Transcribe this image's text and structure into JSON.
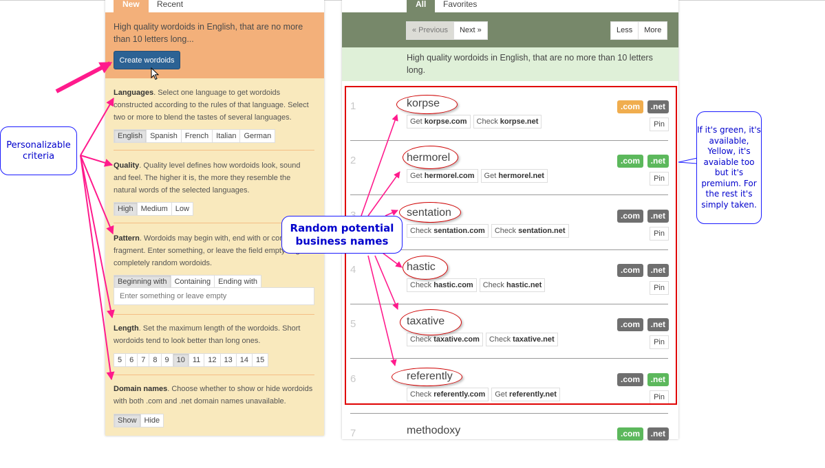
{
  "left_panel": {
    "tabs": [
      {
        "label": "New",
        "active": true
      },
      {
        "label": "Recent",
        "active": false
      }
    ],
    "summary": "High quality wordoids in English, that are no more than 10 letters long...",
    "create_button": "Create wordoids",
    "languages": {
      "title": "Languages",
      "description": ". Select one language to get wordoids constructed according to the rules of that language. Select two or more to blend the tastes of several languages.",
      "options": [
        "English",
        "Spanish",
        "French",
        "Italian",
        "German"
      ],
      "selected": "English"
    },
    "quality": {
      "title": "Quality",
      "description": ". Quality level defines how wordoids look, sound and feel. The higher it is, the more they resemble the natural words of the selected languages.",
      "options": [
        "High",
        "Medium",
        "Low"
      ],
      "selected": "High"
    },
    "pattern": {
      "title": "Pattern",
      "description": ". Wordoids may begin with, end with or contain a fragment. Enter something, or leave the field empty to get completely random wordoids.",
      "options": [
        "Beginning with",
        "Containing",
        "Ending with"
      ],
      "selected": "Beginning with",
      "input_value": "",
      "input_placeholder": "Enter something or leave empty"
    },
    "length": {
      "title": "Length",
      "description": ". Set the maximum length of the wordoids. Short wordoids tend to look better than long ones.",
      "options": [
        "5",
        "6",
        "7",
        "8",
        "9",
        "10",
        "11",
        "12",
        "13",
        "14",
        "15"
      ],
      "selected": "10"
    },
    "domain_names": {
      "title": "Domain names",
      "description": ". Choose whether to show or hide wordoids with both .com and .net domain names unavailable.",
      "options": [
        "Show",
        "Hide"
      ],
      "selected": "Show"
    }
  },
  "right_panel": {
    "tabs": [
      {
        "label": "All",
        "active": true
      },
      {
        "label": "Favorites",
        "active": false
      }
    ],
    "pagination": {
      "previous": "« Previous",
      "next": "Next »"
    },
    "amount": {
      "less": "Less",
      "more": "More"
    },
    "summary": "High quality wordoids in English, that are no more than 10 letters long.",
    "colors": {
      "available": "#5cb85c",
      "premium": "#f0ad4e",
      "taken": "#6f6f6f"
    },
    "results": [
      {
        "num": "1",
        "word": "korpse",
        "com": "premium",
        "net": "taken",
        "links": [
          {
            "verb": "Get",
            "domain": "korpse.com"
          },
          {
            "verb": "Check",
            "domain": "korpse.net"
          }
        ]
      },
      {
        "num": "2",
        "word": "hermorel",
        "com": "available",
        "net": "available",
        "links": [
          {
            "verb": "Get",
            "domain": "hermorel.com"
          },
          {
            "verb": "Get",
            "domain": "hermorel.net"
          }
        ]
      },
      {
        "num": "3",
        "word": "sentation",
        "com": "taken",
        "net": "taken",
        "links": [
          {
            "verb": "Check",
            "domain": "sentation.com"
          },
          {
            "verb": "Check",
            "domain": "sentation.net"
          }
        ]
      },
      {
        "num": "4",
        "word": "hastic",
        "com": "taken",
        "net": "taken",
        "links": [
          {
            "verb": "Check",
            "domain": "hastic.com"
          },
          {
            "verb": "Check",
            "domain": "hastic.net"
          }
        ]
      },
      {
        "num": "5",
        "word": "taxative",
        "com": "taken",
        "net": "taken",
        "links": [
          {
            "verb": "Check",
            "domain": "taxative.com"
          },
          {
            "verb": "Check",
            "domain": "taxative.net"
          }
        ]
      },
      {
        "num": "6",
        "word": "referently",
        "com": "taken",
        "net": "available",
        "links": [
          {
            "verb": "Check",
            "domain": "referently.com"
          },
          {
            "verb": "Get",
            "domain": "referently.net"
          }
        ]
      },
      {
        "num": "7",
        "word": "methodoxy",
        "com": "available",
        "net": "taken",
        "links": []
      }
    ],
    "badge_labels": {
      "com": ".com",
      "net": ".net"
    },
    "pin_label": "Pin"
  },
  "annotations": {
    "criteria_callout": "Personalizable criteria",
    "names_callout": "Random potential business names",
    "legend_callout": "If it's green, it's available, Yellow, it's avaiable too but it's premium. For the rest it's simply taken.",
    "arrow_color": "#ff1a8c",
    "highlight_color": "#e00000"
  }
}
